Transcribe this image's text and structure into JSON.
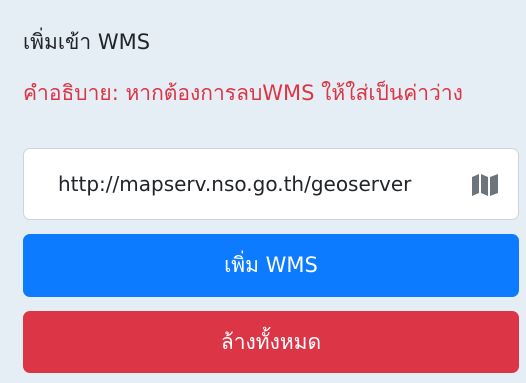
{
  "wms_panel": {
    "title": "เพิ่มเข้า WMS",
    "description": "คำอธิบาย: หากต้องการลบWMS ให้ใส่เป็นค่าว่าง",
    "url_input_value": "http://mapserv.nso.go.th/geoserver",
    "map_icon": "map-icon",
    "add_button_label": "เพิ่ม WMS",
    "clear_button_label": "ล้างทั้งหมด"
  },
  "colors": {
    "panel_background": "#e4eef4",
    "description_text": "#dc3545",
    "add_button": "#0d7bff",
    "clear_button": "#dc3545",
    "icon": "#6c757d"
  }
}
